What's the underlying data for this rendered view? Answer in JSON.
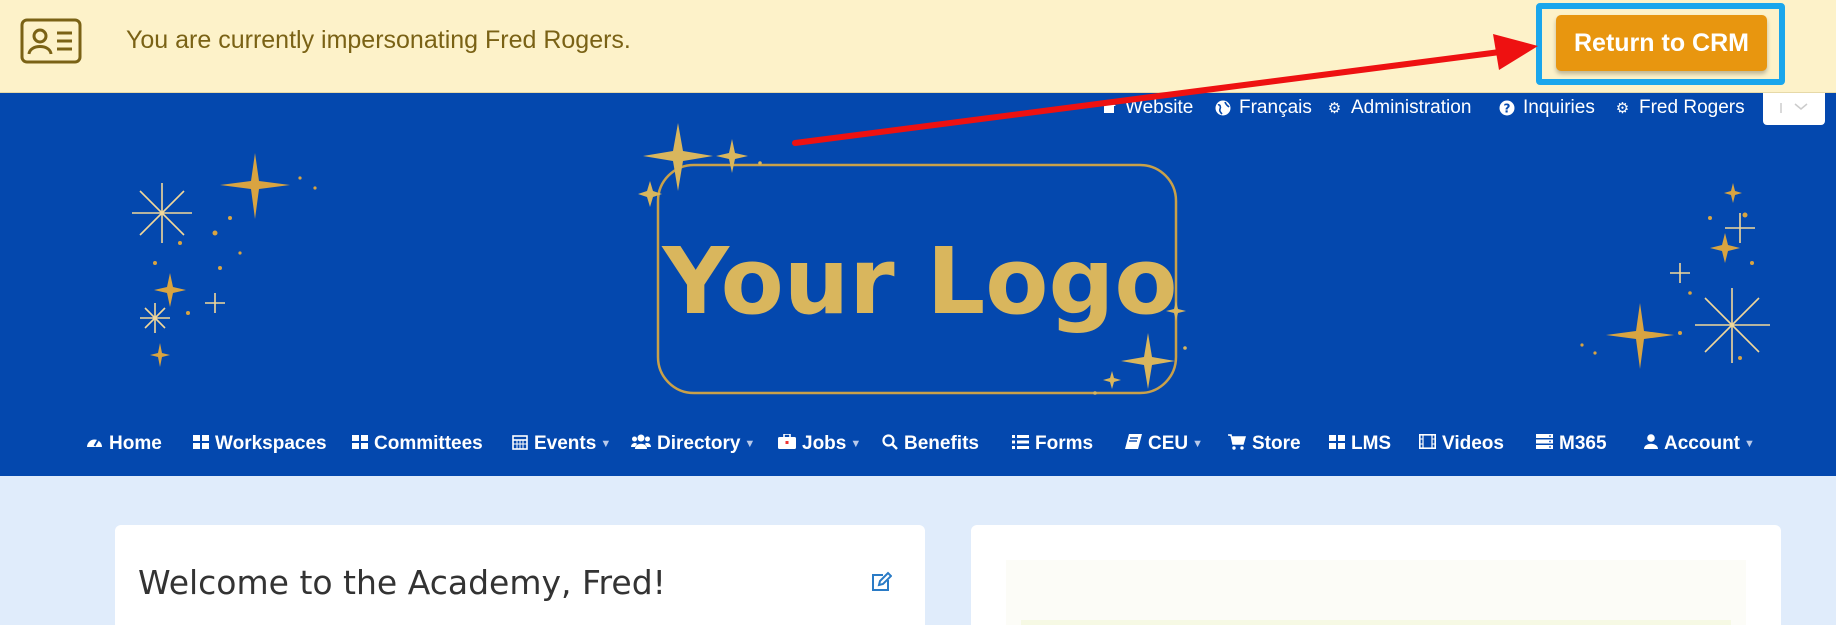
{
  "impersonation_bar": {
    "message": "You are currently impersonating Fred Rogers.",
    "return_button_label": "Return to CRM",
    "icon": "contact-card-icon",
    "highlight_color": "#1aa6ec",
    "button_color": "#e8960f"
  },
  "header": {
    "background_color": "#0448ae",
    "top_links": [
      {
        "label": "Website",
        "icon": "home-icon"
      },
      {
        "label": "Français",
        "icon": "globe-icon"
      },
      {
        "label": "Administration",
        "icon": "gear-icon"
      },
      {
        "label": "Inquiries",
        "icon": "question-icon"
      },
      {
        "label": "Fred Rogers",
        "icon": "gear-icon"
      }
    ],
    "logo_text": "Your Logo",
    "logo_color": "#d9b65d"
  },
  "nav": {
    "items": [
      {
        "label": "Home",
        "icon": "dashboard-icon",
        "dropdown": false
      },
      {
        "label": "Workspaces",
        "icon": "grid-icon",
        "dropdown": false
      },
      {
        "label": "Committees",
        "icon": "grid-icon",
        "dropdown": false
      },
      {
        "label": "Events",
        "icon": "calendar-icon",
        "dropdown": true
      },
      {
        "label": "Directory",
        "icon": "users-icon",
        "dropdown": true
      },
      {
        "label": "Jobs",
        "icon": "briefcase-icon",
        "dropdown": true
      },
      {
        "label": "Benefits",
        "icon": "search-icon",
        "dropdown": false
      },
      {
        "label": "Forms",
        "icon": "list-icon",
        "dropdown": false
      },
      {
        "label": "CEU",
        "icon": "book-icon",
        "dropdown": true
      },
      {
        "label": "Store",
        "icon": "cart-icon",
        "dropdown": false
      },
      {
        "label": "LMS",
        "icon": "grid-icon",
        "dropdown": false
      },
      {
        "label": "Videos",
        "icon": "film-icon",
        "dropdown": false
      },
      {
        "label": "M365",
        "icon": "server-icon",
        "dropdown": false
      },
      {
        "label": "Account",
        "icon": "user-icon",
        "dropdown": true
      }
    ]
  },
  "main": {
    "welcome_title": "Welcome to the Academy, Fred!"
  },
  "annotation": {
    "arrow_color": "#ee1111"
  }
}
